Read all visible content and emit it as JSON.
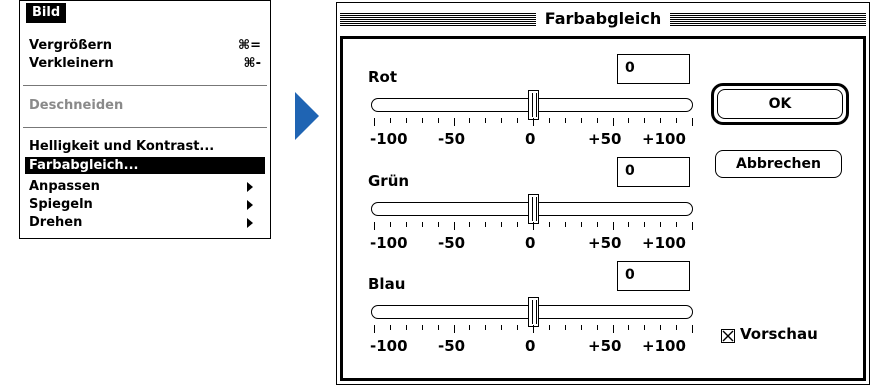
{
  "menu": {
    "title": "Bild",
    "items": [
      {
        "label": "Vergrößern",
        "shortcut": "⌘="
      },
      {
        "label": "Verkleinern",
        "shortcut": "⌘-"
      },
      {
        "label": "Deschneiden"
      },
      {
        "label": "Helligkeit und Kontrast..."
      },
      {
        "label": "Farbabgleich..."
      },
      {
        "label": "Anpassen"
      },
      {
        "label": "Spiegeln"
      },
      {
        "label": "Drehen"
      }
    ]
  },
  "dialog": {
    "title": "Farbabgleich",
    "channels": [
      {
        "label": "Rot",
        "value": "0",
        "position_fraction": 0.5
      },
      {
        "label": "Grün",
        "value": "0",
        "position_fraction": 0.5
      },
      {
        "label": "Blau",
        "value": "0",
        "position_fraction": 0.5
      }
    ],
    "scale_labels": [
      "-100",
      "-50",
      "0",
      "+50",
      "+100"
    ],
    "ok_label": "OK",
    "cancel_label": "Abbrechen",
    "preview": {
      "label": "Vorschau",
      "checked": true
    }
  },
  "colors": {
    "pointer": "#1f64b3",
    "disabled_text": "#8a8a8a"
  }
}
